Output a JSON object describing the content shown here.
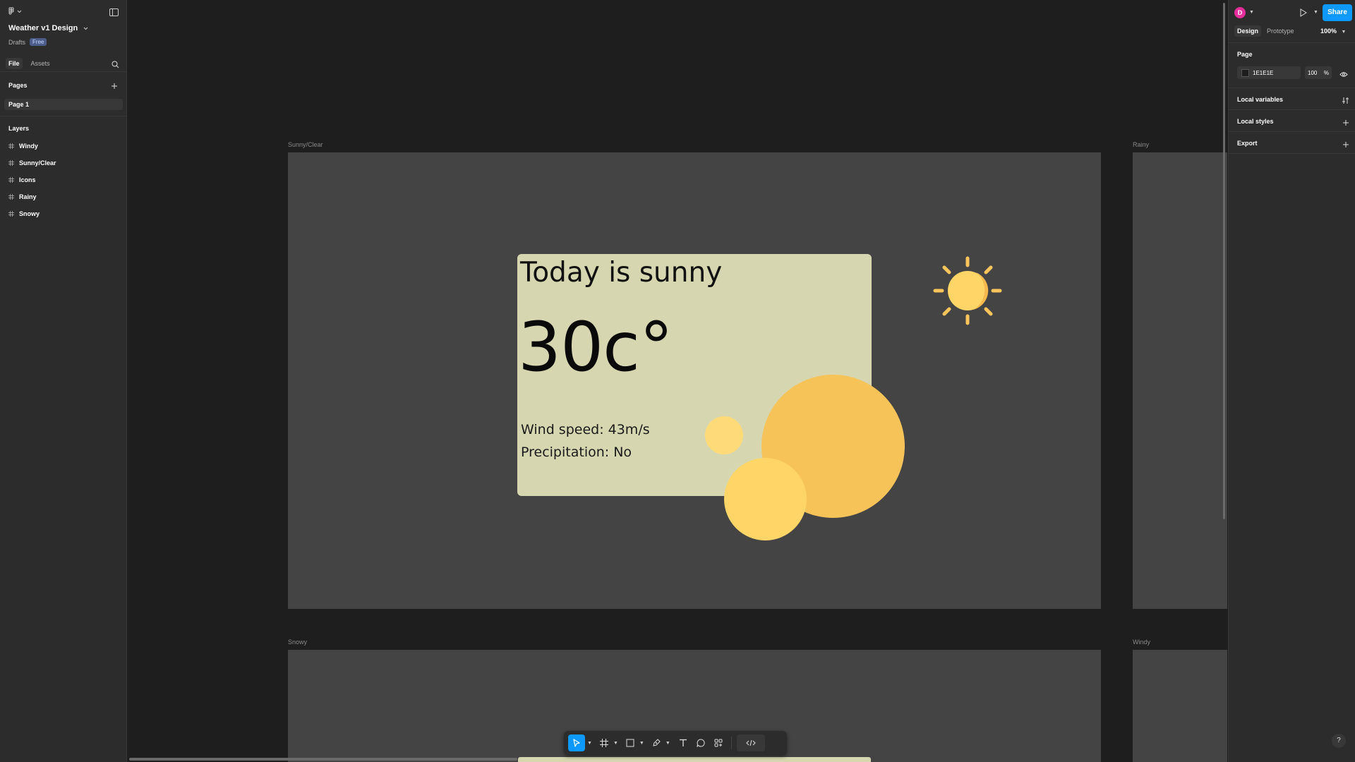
{
  "file": {
    "title": "Weather v1 Design",
    "location": "Drafts",
    "plan": "Free"
  },
  "left_panel": {
    "tabs": [
      "File",
      "Assets"
    ],
    "pages_heading": "Pages",
    "pages": [
      "Page 1"
    ],
    "layers_heading": "Layers",
    "layers": [
      "Windy",
      "Sunny/Clear",
      "Icons",
      "Rainy",
      "Snowy"
    ]
  },
  "canvas": {
    "frames": {
      "sunny": "Sunny/Clear",
      "rainy": "Rainy",
      "snowy": "Snowy",
      "windy": "Windy"
    },
    "card": {
      "title": "Today is sunny",
      "temperature": "30c°",
      "wind": "Wind speed: 43m/s",
      "precipitation": "Precipitation: No"
    }
  },
  "right_panel": {
    "avatar_initial": "D",
    "share_label": "Share",
    "tabs": [
      "Design",
      "Prototype"
    ],
    "zoom": "100%",
    "page_heading": "Page",
    "page_fill_hex": "1E1E1E",
    "page_fill_opacity": "100",
    "opacity_unit": "%",
    "local_variables": "Local variables",
    "local_styles": "Local styles",
    "export": "Export",
    "help": "?"
  },
  "colors": {
    "accent": "#0d99ff",
    "avatar": "#e52d9b",
    "card_bg": "#d6d6b1",
    "sun_orange": "#f6c359",
    "sun_yellow": "#fed566",
    "frame_bg": "#444444",
    "canvas_bg": "#1e1e1e"
  },
  "icons": {
    "toolbar": [
      "move-icon",
      "frame-icon",
      "rectangle-icon",
      "pen-icon",
      "text-icon",
      "comment-icon",
      "actions-icon",
      "dev-mode-icon"
    ]
  }
}
